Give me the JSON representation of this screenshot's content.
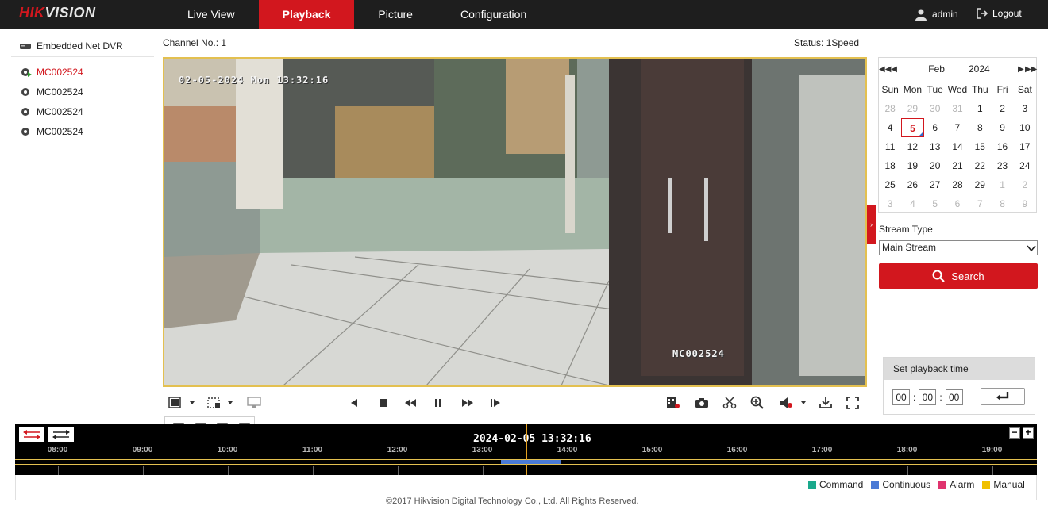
{
  "brand": {
    "part1": "HIK",
    "part2": "VISION"
  },
  "nav": [
    {
      "label": "Live View"
    },
    {
      "label": "Playback"
    },
    {
      "label": "Picture"
    },
    {
      "label": "Configuration"
    }
  ],
  "user": {
    "name": "admin",
    "logout": "Logout"
  },
  "left_panel": {
    "device": "Embedded Net DVR",
    "channels": [
      "MC002524",
      "MC002524",
      "MC002524",
      "MC002524"
    ]
  },
  "video_header": {
    "channel": "Channel No.: 1",
    "status": "Status: 1Speed"
  },
  "osd": {
    "time": "02-05-2024 Mon 13:32:16",
    "name": "MC002524"
  },
  "calendar": {
    "month": "Feb",
    "year": "2024",
    "weekdays": [
      "Sun",
      "Mon",
      "Tue",
      "Wed",
      "Thu",
      "Fri",
      "Sat"
    ],
    "days": [
      "28",
      "29",
      "30",
      "31",
      "1",
      "2",
      "3",
      "4",
      "5",
      "6",
      "7",
      "8",
      "9",
      "10",
      "11",
      "12",
      "13",
      "14",
      "15",
      "16",
      "17",
      "18",
      "19",
      "20",
      "21",
      "22",
      "23",
      "24",
      "25",
      "26",
      "27",
      "28",
      "29",
      "1",
      "2",
      "3",
      "4",
      "5",
      "6",
      "7",
      "8",
      "9"
    ],
    "selected": "5"
  },
  "stream": {
    "label": "Stream Type",
    "value": "Main Stream"
  },
  "search_label": "Search",
  "playback_time": {
    "title": "Set playback time",
    "hh": "00",
    "mm": "00",
    "ss": "00"
  },
  "timeline": {
    "current": "2024-02-05 13:32:16",
    "hours": [
      "08:00",
      "09:00",
      "10:00",
      "11:00",
      "12:00",
      "13:00",
      "14:00",
      "15:00",
      "16:00",
      "17:00",
      "18:00",
      "19:00"
    ],
    "recording": {
      "start": "13:13",
      "end": "13:55",
      "type": "Continuous"
    },
    "zoom_out": "−",
    "zoom_in": "+"
  },
  "legend": [
    {
      "label": "Command",
      "color": "#1aa98c"
    },
    {
      "label": "Continuous",
      "color": "#4a7ad6"
    },
    {
      "label": "Alarm",
      "color": "#e0336e"
    },
    {
      "label": "Manual",
      "color": "#f0c000"
    }
  ],
  "colors": {
    "accent": "#d2171e",
    "topbar": "#1e1e1e",
    "highlight": "#e3c050"
  },
  "footer": "©2017 Hikvision Digital Technology Co., Ltd. All Rights Reserved."
}
